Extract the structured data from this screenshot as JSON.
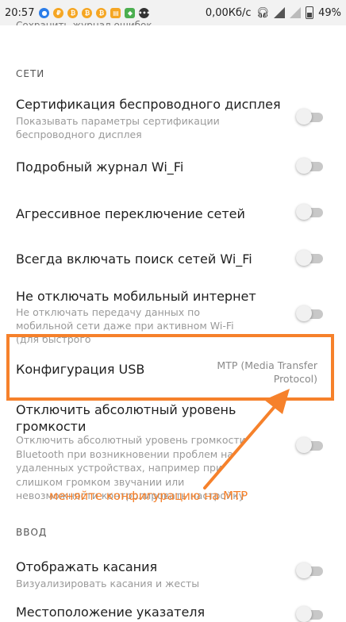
{
  "status_bar": {
    "time": "20:57",
    "net_speed": "0,00Кб/с",
    "battery": "49%",
    "notification_icons": [
      "location-icon",
      "ruble-icon",
      "bitcoin-icon",
      "bitcoin-icon",
      "bitcoin-icon",
      "gift-icon",
      "shield-icon",
      "dots-icon"
    ],
    "right_icons": [
      "headphones-icon",
      "signal-icon",
      "signal-weak-icon",
      "battery-icon"
    ]
  },
  "top_cut_text": "Сохранить журнал ошибок",
  "sections": {
    "network": "СЕТИ",
    "input": "ВВОД"
  },
  "items": [
    {
      "title": "Сертификация беспроводного дисплея",
      "subtitle": "Показывать параметры сертификации беспроводного дисплея"
    },
    {
      "title": "Подробный журнал Wi_Fi",
      "subtitle": ""
    },
    {
      "title": "Агрессивное переключение сетей",
      "subtitle": ""
    },
    {
      "title": "Всегда включать поиск сетей Wi_Fi",
      "subtitle": ""
    },
    {
      "title": "Не отключать мобильный интернет",
      "subtitle": "Не отключать передачу данных по мобильной сети даже при активном Wi-Fi (для быстрого"
    },
    {
      "title": "Конфигурация USB",
      "value": "MTP (Media Transfer Protocol)"
    },
    {
      "title": "Отключить абсолютный уровень громкости",
      "subtitle": "Отключить абсолютный уровень громкости Bluetooth при возникновении проблем на удаленных устройствах, например при слишком громком звучании или невозможности контролировать настройку"
    },
    {
      "title": "Отображать касания",
      "subtitle": "Визуализировать касания и жесты"
    },
    {
      "title": "Местоположение указателя",
      "subtitle": ""
    }
  ],
  "annotation": {
    "text": "меняйте конфигурацию на MTP",
    "color": "#f6812b"
  },
  "toggles_state": "off"
}
